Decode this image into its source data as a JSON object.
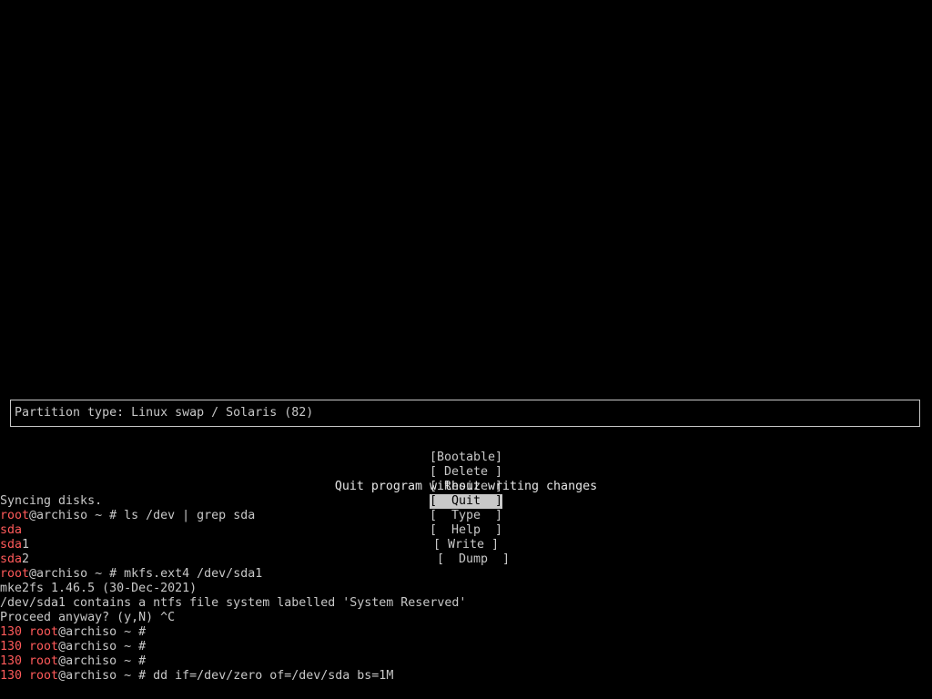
{
  "colors": {
    "background": "#000000",
    "foreground": "#c8c8c8",
    "prompt_red": "#ff5a5a",
    "selection_bg": "#c8c8c8"
  },
  "cfdisk": {
    "info_text": "Partition type: Linux swap / Solaris (82)",
    "menu": [
      {
        "label": "[Bootable]",
        "selected": false
      },
      {
        "label": "[ Delete ]",
        "selected": false
      },
      {
        "label": "[ Resize ]",
        "selected": false
      },
      {
        "label": "[  Quit  ]",
        "selected": true
      },
      {
        "label": "[  Type  ]",
        "selected": false
      },
      {
        "label": "[  Help  ]",
        "selected": false
      },
      {
        "label": "[ Write ]",
        "selected": false
      },
      {
        "label": "[  Dump  ]",
        "selected": false
      }
    ],
    "help_text": "Quit program without writing changes"
  },
  "terminal": {
    "lines": [
      {
        "plain": "Syncing disks."
      },
      {
        "prompt_user": "root",
        "prompt_host": "@archiso ~ # ",
        "command": "ls /dev | grep sda"
      },
      {
        "red": "sda",
        "plain": ""
      },
      {
        "red": "sda",
        "plain": "1"
      },
      {
        "red": "sda",
        "plain": "2"
      },
      {
        "prompt_user": "root",
        "prompt_host": "@archiso ~ # ",
        "command": "mkfs.ext4 /dev/sda1"
      },
      {
        "plain": "mke2fs 1.46.5 (30-Dec-2021)"
      },
      {
        "plain": "/dev/sda1 contains a ntfs file system labelled 'System Reserved'"
      },
      {
        "plain": "Proceed anyway? (y,N) ^C"
      },
      {
        "exit_code": "130 ",
        "prompt_user": "root",
        "prompt_host": "@archiso ~ # ",
        "command": ""
      },
      {
        "exit_code": "130 ",
        "prompt_user": "root",
        "prompt_host": "@archiso ~ # ",
        "command": ""
      },
      {
        "exit_code": "130 ",
        "prompt_user": "root",
        "prompt_host": "@archiso ~ # ",
        "command": ""
      },
      {
        "exit_code": "130 ",
        "prompt_user": "root",
        "prompt_host": "@archiso ~ # ",
        "command": "dd if=/dev/zero of=/dev/sda bs=1M"
      }
    ]
  }
}
